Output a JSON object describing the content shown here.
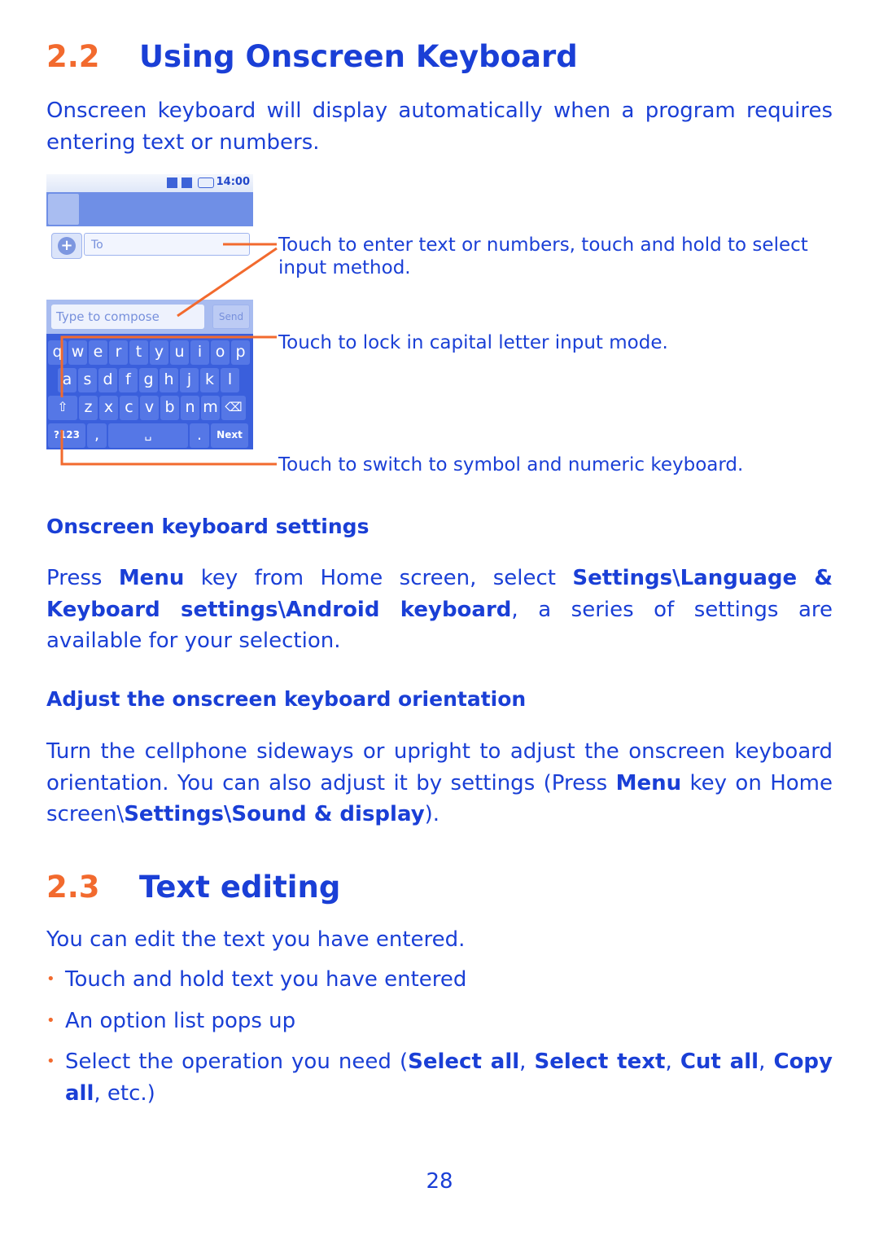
{
  "section_2_2": {
    "number": "2.2",
    "title": "Using Onscreen Keyboard",
    "intro": "Onscreen keyboard will display automatically when a program requires entering text or numbers."
  },
  "illustration": {
    "status_time": "14:00",
    "to_field_value": "To",
    "compose_placeholder": "Type to compose",
    "send_label": "Send",
    "keyboard_rows": [
      [
        "q",
        "w",
        "e",
        "r",
        "t",
        "y",
        "u",
        "i",
        "o",
        "p"
      ],
      [
        "a",
        "s",
        "d",
        "f",
        "g",
        "h",
        "j",
        "k",
        "l"
      ],
      [
        "⇧",
        "z",
        "x",
        "c",
        "v",
        "b",
        "n",
        "m",
        "⌫"
      ],
      [
        "?123",
        ",",
        "␣",
        ".",
        "Next"
      ]
    ],
    "callouts": [
      "Touch to enter text or numbers, touch and hold to select input method.",
      "Touch to lock in capital letter input mode.",
      "Touch to switch to symbol and numeric keyboard."
    ]
  },
  "keyboard_settings": {
    "heading": "Onscreen keyboard settings",
    "p1": "Press ",
    "menu": "Menu",
    "p2": " key from Home screen, select ",
    "path": "Settings\\Language & Keyboard settings\\Android keyboard",
    "p3": ", a series of settings are available for your selection."
  },
  "orientation": {
    "heading": "Adjust the onscreen keyboard orientation",
    "p1": "Turn the cellphone sideways or upright to adjust the onscreen keyboard orientation. You can also adjust it by settings (Press ",
    "menu": "Menu",
    "p2": " key on Home screen\\",
    "path": "Settings\\Sound & display",
    "p3": ")."
  },
  "section_2_3": {
    "number": "2.3",
    "title": "Text editing",
    "intro": "You can edit the text you have entered.",
    "bullets": [
      "Touch and hold text you have entered",
      "An option list pops up"
    ],
    "bullet3_prefix": "Select the operation you need (",
    "op1": "Select all",
    "op2": "Select text",
    "op3": "Cut all",
    "op4": "Copy all",
    "sep": ", ",
    "bullet3_suffix": ", etc.)",
    "bullet_mark": "•"
  },
  "page_number": "28"
}
